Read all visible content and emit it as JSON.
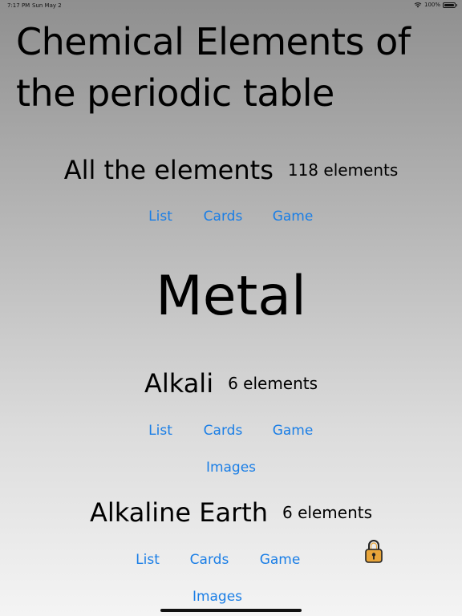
{
  "status_bar": {
    "time": "7:17 PM",
    "date": "Sun May 2",
    "battery": "100%"
  },
  "page": {
    "title": "Chemical Elements of the periodic table"
  },
  "all_elements": {
    "name": "All the elements",
    "count": "118 elements",
    "links": [
      "List",
      "Cards",
      "Game"
    ]
  },
  "metal_section": {
    "title": "Metal",
    "groups": [
      {
        "name": "Alkali",
        "count": "6 elements",
        "links": [
          "List",
          "Cards",
          "Game",
          "Images"
        ]
      },
      {
        "name": "Alkaline Earth",
        "count": "6 elements",
        "links": [
          "List",
          "Cards",
          "Game",
          "Images"
        ]
      }
    ]
  },
  "icons": {
    "status": [
      "wifi-icon",
      "battery-icon"
    ],
    "locked": "lock-icon"
  },
  "colors": {
    "link": "#1a7ee6",
    "lock": "#e8a53a"
  }
}
